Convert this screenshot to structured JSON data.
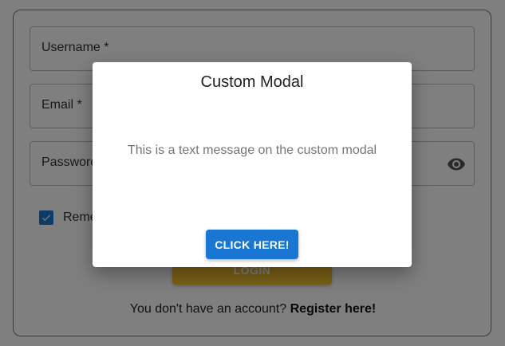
{
  "form": {
    "username_label": "Username *",
    "email_label": "Email *",
    "password_label": "Password",
    "remember_label": "Remember me",
    "remember_checked": true,
    "login_label": "LOGIN",
    "register_prompt": "You don't have an account?",
    "register_link": "Register here!"
  },
  "modal": {
    "title": "Custom Modal",
    "message": "This is a text message on the custom modal",
    "button_label": "CLICK HERE!"
  },
  "colors": {
    "primary": "#1976d2",
    "login_button": "#f2c12e",
    "backdrop": "rgba(0,0,0,0.5)"
  },
  "icons": {
    "password_toggle": "eye-icon",
    "checkbox": "check-icon"
  }
}
